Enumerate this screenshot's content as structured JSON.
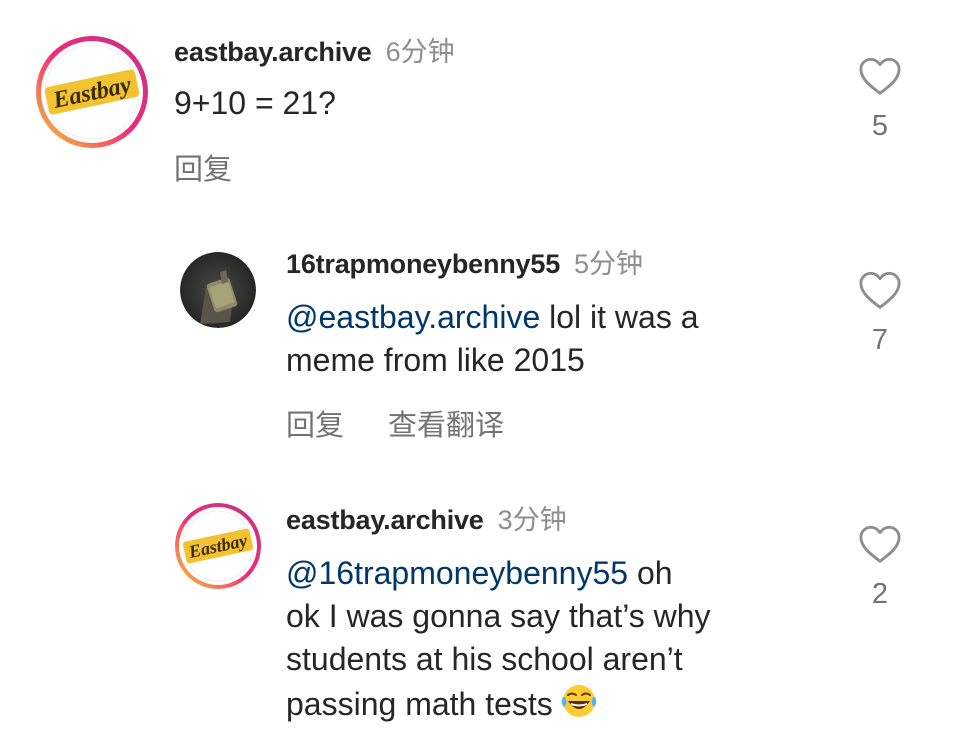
{
  "comments": [
    {
      "username": "eastbay.archive",
      "time": "6分钟",
      "text": "9+10 = 21?",
      "reply_label": "回复",
      "likes": "5",
      "avatar_text": "Eastbay"
    },
    {
      "username": "16trapmoneybenny55",
      "time": "5分钟",
      "mention": "@eastbay.archive",
      "text_line1": " lol it was a",
      "text_line2": "meme from like 2015",
      "reply_label": "回复",
      "translate_label": "查看翻译",
      "likes": "7"
    },
    {
      "username": "eastbay.archive",
      "time": "3分钟",
      "mention": "@16trapmoneybenny55",
      "text_line1": " oh",
      "text_line2": "ok I was gonna say that’s why",
      "text_line3": "students at his school aren’t",
      "text_line4": "passing math tests",
      "likes": "2",
      "avatar_text": "Eastbay"
    }
  ],
  "colors": {
    "username": "#262626",
    "muted": "#8e8e8e",
    "mention": "#00376b",
    "story_ring_start": "#f9ce34",
    "story_ring_mid": "#ee2a7b",
    "story_ring_end": "#6228d7"
  }
}
